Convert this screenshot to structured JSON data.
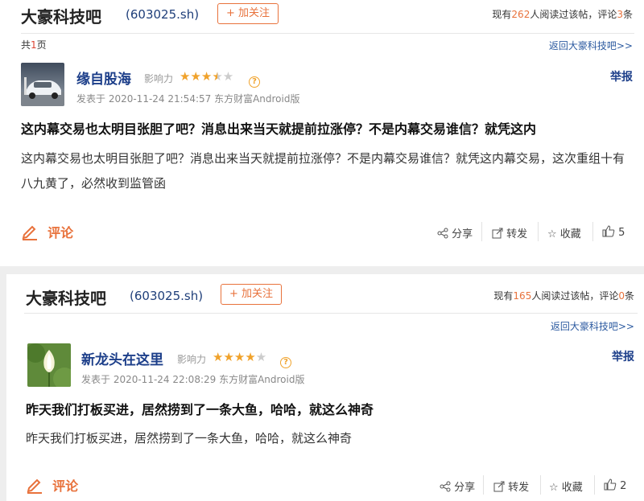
{
  "posts": [
    {
      "bar_title": "大豪科技吧",
      "stock_code": "(603025.sh)",
      "follow_label": "+ 加关注",
      "stats_prefix": "现有",
      "readers": "262",
      "stats_middle": "人阅读过该帖，评论",
      "comments": "3",
      "stats_suffix": "条",
      "page_prefix": "共",
      "page_num": "1",
      "page_suffix": "页",
      "back_link": "返回大豪科技吧>>",
      "username": "缘自股海",
      "influence_label": "影响力",
      "stars_on": "★★★",
      "stars_half": "★",
      "stars_off": "★",
      "help_mark": "?",
      "meta": "发表于 2020-11-24 21:54:57 东方财富Android版",
      "report_label": "举报",
      "title": "这内幕交易也太明目张胆了吧？消息出来当天就提前拉涨停？不是内幕交易谁信？就凭这内",
      "body": "这内幕交易也太明目张胆了吧？消息出来当天就提前拉涨停？不是内幕交易谁信？就凭这内幕交易，这次重组十有八九黄了，必然收到监管函",
      "comment_label": "评论",
      "share_label": "分享",
      "forward_label": "转发",
      "fav_label": "收藏",
      "likes": "5"
    },
    {
      "bar_title": "大豪科技吧",
      "stock_code": "(603025.sh)",
      "follow_label": "+ 加关注",
      "stats_prefix": "现有",
      "readers": "165",
      "stats_middle": "人阅读过该帖，评论",
      "comments": "0",
      "stats_suffix": "条",
      "back_link": "返回大豪科技吧>>",
      "username": "新龙头在这里",
      "influence_label": "影响力",
      "stars_on": "★★★★",
      "stars_off": "★",
      "help_mark": "?",
      "meta": "发表于 2020-11-24 22:08:29 东方财富Android版",
      "report_label": "举报",
      "title": "昨天我们打板买进，居然捞到了一条大鱼，哈哈，就这么神奇",
      "body": "昨天我们打板买进，居然捞到了一条大鱼，哈哈，就这么神奇",
      "comment_label": "评论",
      "share_label": "分享",
      "forward_label": "转发",
      "fav_label": "收藏",
      "likes": "2"
    }
  ],
  "colors": {
    "accent": "#e8723c",
    "link": "#1d3f8a",
    "star": "#f0a22b"
  }
}
